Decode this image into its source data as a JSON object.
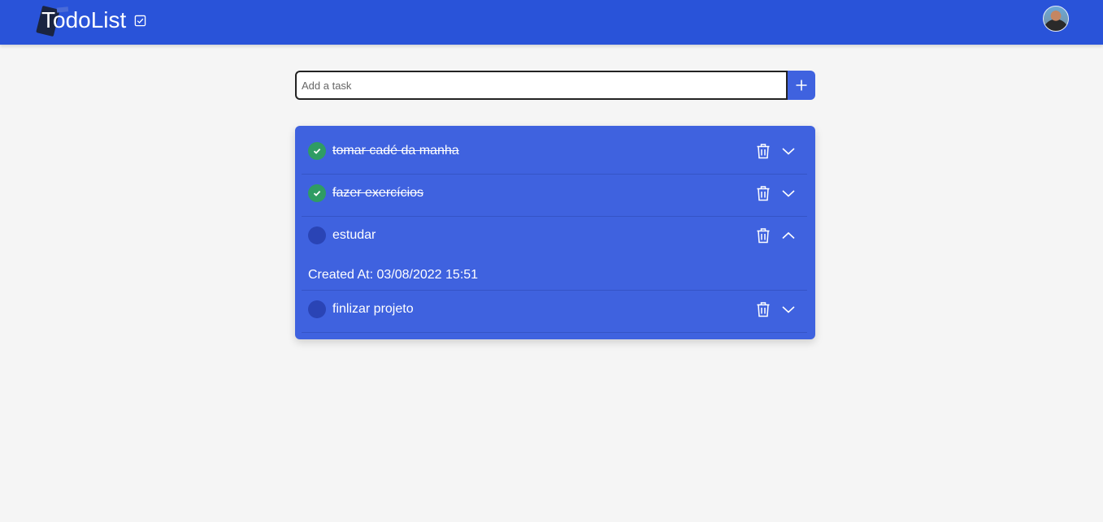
{
  "header": {
    "title": "TodoList",
    "brand_icon": "checkbox-icon",
    "avatar": "user-avatar",
    "colors": {
      "bar": "#2953d9"
    }
  },
  "add_task": {
    "placeholder": "Add a task",
    "value": "",
    "button_icon": "plus-icon"
  },
  "tasks": [
    {
      "label": "tomar cadé da manha",
      "done": true,
      "expanded": false
    },
    {
      "label": "fazer exercícios",
      "done": true,
      "expanded": false
    },
    {
      "label": "estudar",
      "done": false,
      "expanded": true,
      "created_at": "Created At: 03/08/2022 15:51"
    },
    {
      "label": "finlizar projeto",
      "done": false,
      "expanded": false
    }
  ],
  "colors": {
    "panel": "#3f62df",
    "done": "#2f9c63",
    "pending": "#2a44b5",
    "background": "#f5f5f5"
  }
}
